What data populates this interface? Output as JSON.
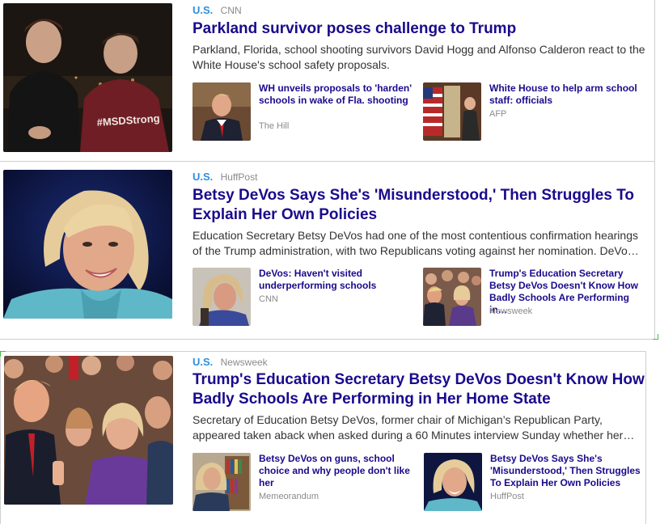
{
  "stories": [
    {
      "category": "U.S.",
      "source": "CNN",
      "headline": "Parkland survivor poses challenge to Trump",
      "summary": "Parkland, Florida, school shooting survivors David Hogg and Alfonso Calderon react to the White House's school safety proposals.",
      "hero_shirt_text": "#MSDStrong",
      "related": [
        {
          "title": "WH unveils proposals to 'harden' schools in wake of Fla. shooting",
          "source": "The Hill"
        },
        {
          "title": "White House to help arm school staff: officials",
          "source": "AFP"
        }
      ]
    },
    {
      "category": "U.S.",
      "source": "HuffPost",
      "headline": "Betsy DeVos Says She's 'Misunderstood,' Then Struggles To Explain Her Own Policies",
      "summary": "Education Secretary Betsy DeVos had one of the most contentious confirmation hearings of the Trump administration, with two Republicans voting against her nomination. DeVo…",
      "related": [
        {
          "title": "DeVos: Haven't visited underperforming schools",
          "source": "CNN"
        },
        {
          "title": "Trump's Education Secretary Betsy DeVos Doesn't Know How Badly Schools Are Performing in…",
          "source": "Newsweek"
        }
      ]
    },
    {
      "category": "U.S.",
      "source": "Newsweek",
      "headline": "Trump's Education Secretary Betsy DeVos Doesn't Know How Badly Schools Are Performing in Her Home State",
      "summary": "Secretary of Education Betsy DeVos, former chair of Michigan’s Republican Party, appeared taken aback when asked during a 60 Minutes interview Sunday whether her…",
      "related": [
        {
          "title": "Betsy DeVos on guns, school choice and why people don't like her",
          "source": "Memeorandum"
        },
        {
          "title": "Betsy DeVos Says She's 'Misunderstood,' Then Struggles To Explain Her Own Policies",
          "source": "HuffPost"
        }
      ]
    }
  ],
  "colors": {
    "headline": "#1a0a8c",
    "category": "#2c8fde",
    "source": "#8a8a8a",
    "summary": "#333333",
    "divider": "#cfcfcf",
    "focus_corner": "#3cc23c"
  },
  "icons": {
    "hero_1": "photo-two-students",
    "hero_2": "photo-betsy-devos",
    "hero_3": "photo-trump-rally"
  }
}
